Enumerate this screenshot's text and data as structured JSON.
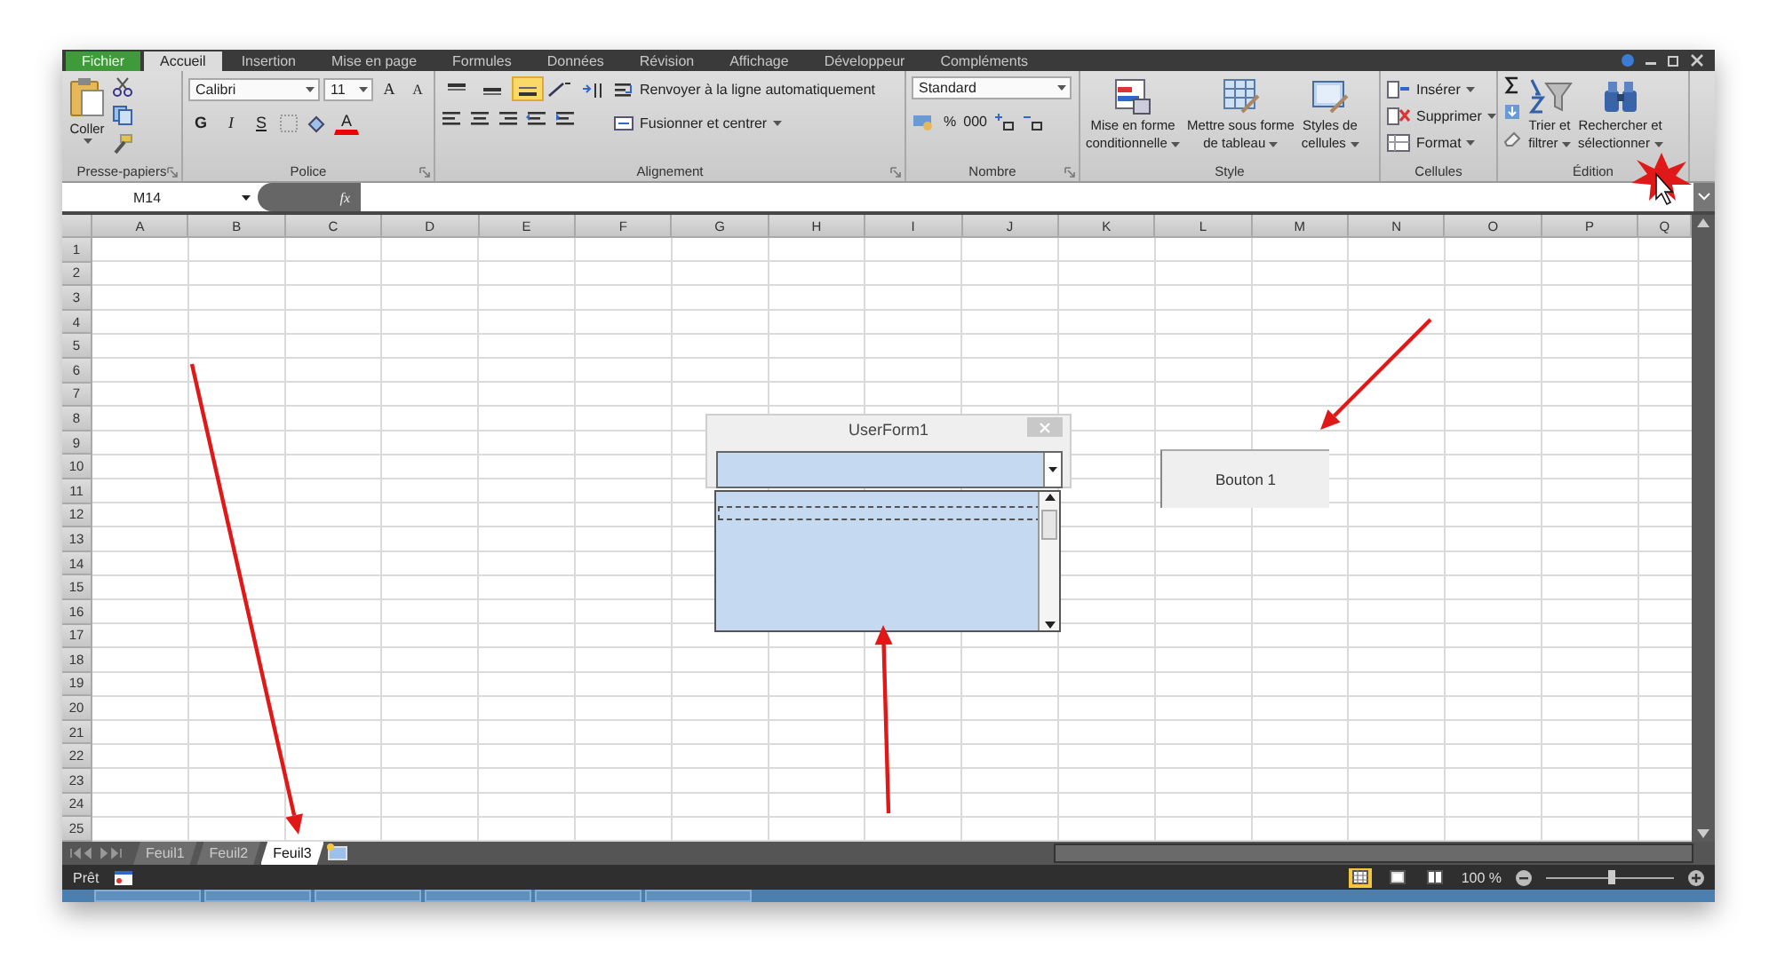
{
  "ribbon_tabs": [
    {
      "label": "Fichier",
      "kind": "file",
      "selected": false
    },
    {
      "label": "Accueil",
      "kind": "tab",
      "selected": true
    },
    {
      "label": "Insertion",
      "kind": "tab",
      "selected": false
    },
    {
      "label": "Mise en page",
      "kind": "tab",
      "selected": false
    },
    {
      "label": "Formules",
      "kind": "tab",
      "selected": false
    },
    {
      "label": "Données",
      "kind": "tab",
      "selected": false
    },
    {
      "label": "Révision",
      "kind": "tab",
      "selected": false
    },
    {
      "label": "Affichage",
      "kind": "tab",
      "selected": false
    },
    {
      "label": "Développeur",
      "kind": "tab",
      "selected": false
    },
    {
      "label": "Compléments",
      "kind": "tab",
      "selected": false
    }
  ],
  "clipboard": {
    "paste": "Coller",
    "label": "Presse-papiers"
  },
  "font": {
    "name": "Calibri",
    "size": "11",
    "grow": "A",
    "shrink": "A",
    "bold": "G",
    "italic": "I",
    "underline": "S",
    "color_letter": "A",
    "label": "Police"
  },
  "alignment": {
    "valign": [
      {
        "selected": false
      },
      {
        "selected": false
      },
      {
        "selected": true
      }
    ],
    "wrap": "Renvoyer à la ligne automatiquement",
    "merge": "Fusionner et centrer",
    "label": "Alignement"
  },
  "number": {
    "format": "Standard",
    "percent": "%",
    "thousands": "000",
    "label": "Nombre"
  },
  "style": {
    "items": [
      {
        "kind": "conditional",
        "lines": [
          "Mise en forme",
          "conditionnelle"
        ]
      },
      {
        "kind": "table",
        "lines": [
          "Mettre sous forme",
          "de tableau"
        ]
      },
      {
        "kind": "cellstyle",
        "lines": [
          "Styles de",
          "cellules"
        ]
      }
    ],
    "label": "Style"
  },
  "cells": {
    "items": [
      {
        "kind": "insert",
        "label": "Insérer"
      },
      {
        "kind": "delete",
        "label": "Supprimer"
      },
      {
        "kind": "format",
        "label": "Format"
      }
    ],
    "label": "Cellules"
  },
  "editing": {
    "items": [
      {
        "kind": "sort",
        "lines": [
          "Trier et",
          "filtrer"
        ]
      },
      {
        "kind": "find",
        "lines": [
          "Rechercher et",
          "sélectionner"
        ]
      }
    ],
    "label": "Édition"
  },
  "formula_bar": {
    "name_box": "M14",
    "fx": "fx"
  },
  "columns": [
    "A",
    "B",
    "C",
    "D",
    "E",
    "F",
    "G",
    "H",
    "I",
    "J",
    "K",
    "L",
    "M",
    "N",
    "O",
    "P",
    "Q"
  ],
  "rows": [
    "1",
    "2",
    "3",
    "4",
    "5",
    "6",
    "7",
    "8",
    "9",
    "10",
    "11",
    "12",
    "13",
    "14",
    "15",
    "16",
    "17",
    "18",
    "19",
    "20",
    "21",
    "22",
    "23",
    "24",
    "25"
  ],
  "userform": {
    "title": "UserForm1"
  },
  "sheet_button": {
    "label": "Bouton 1"
  },
  "sheet_tabs": [
    {
      "label": "Feuil1",
      "selected": false
    },
    {
      "label": "Feuil2",
      "selected": false
    },
    {
      "label": "Feuil3",
      "selected": true
    }
  ],
  "status": {
    "text": "Prêt",
    "view_buttons": [
      {
        "kind": "normal",
        "selected": true
      },
      {
        "kind": "layout",
        "selected": false
      },
      {
        "kind": "pagebreak",
        "selected": false
      }
    ],
    "zoom": "100 %",
    "zoom_slider": {
      "level": 0.52
    }
  }
}
